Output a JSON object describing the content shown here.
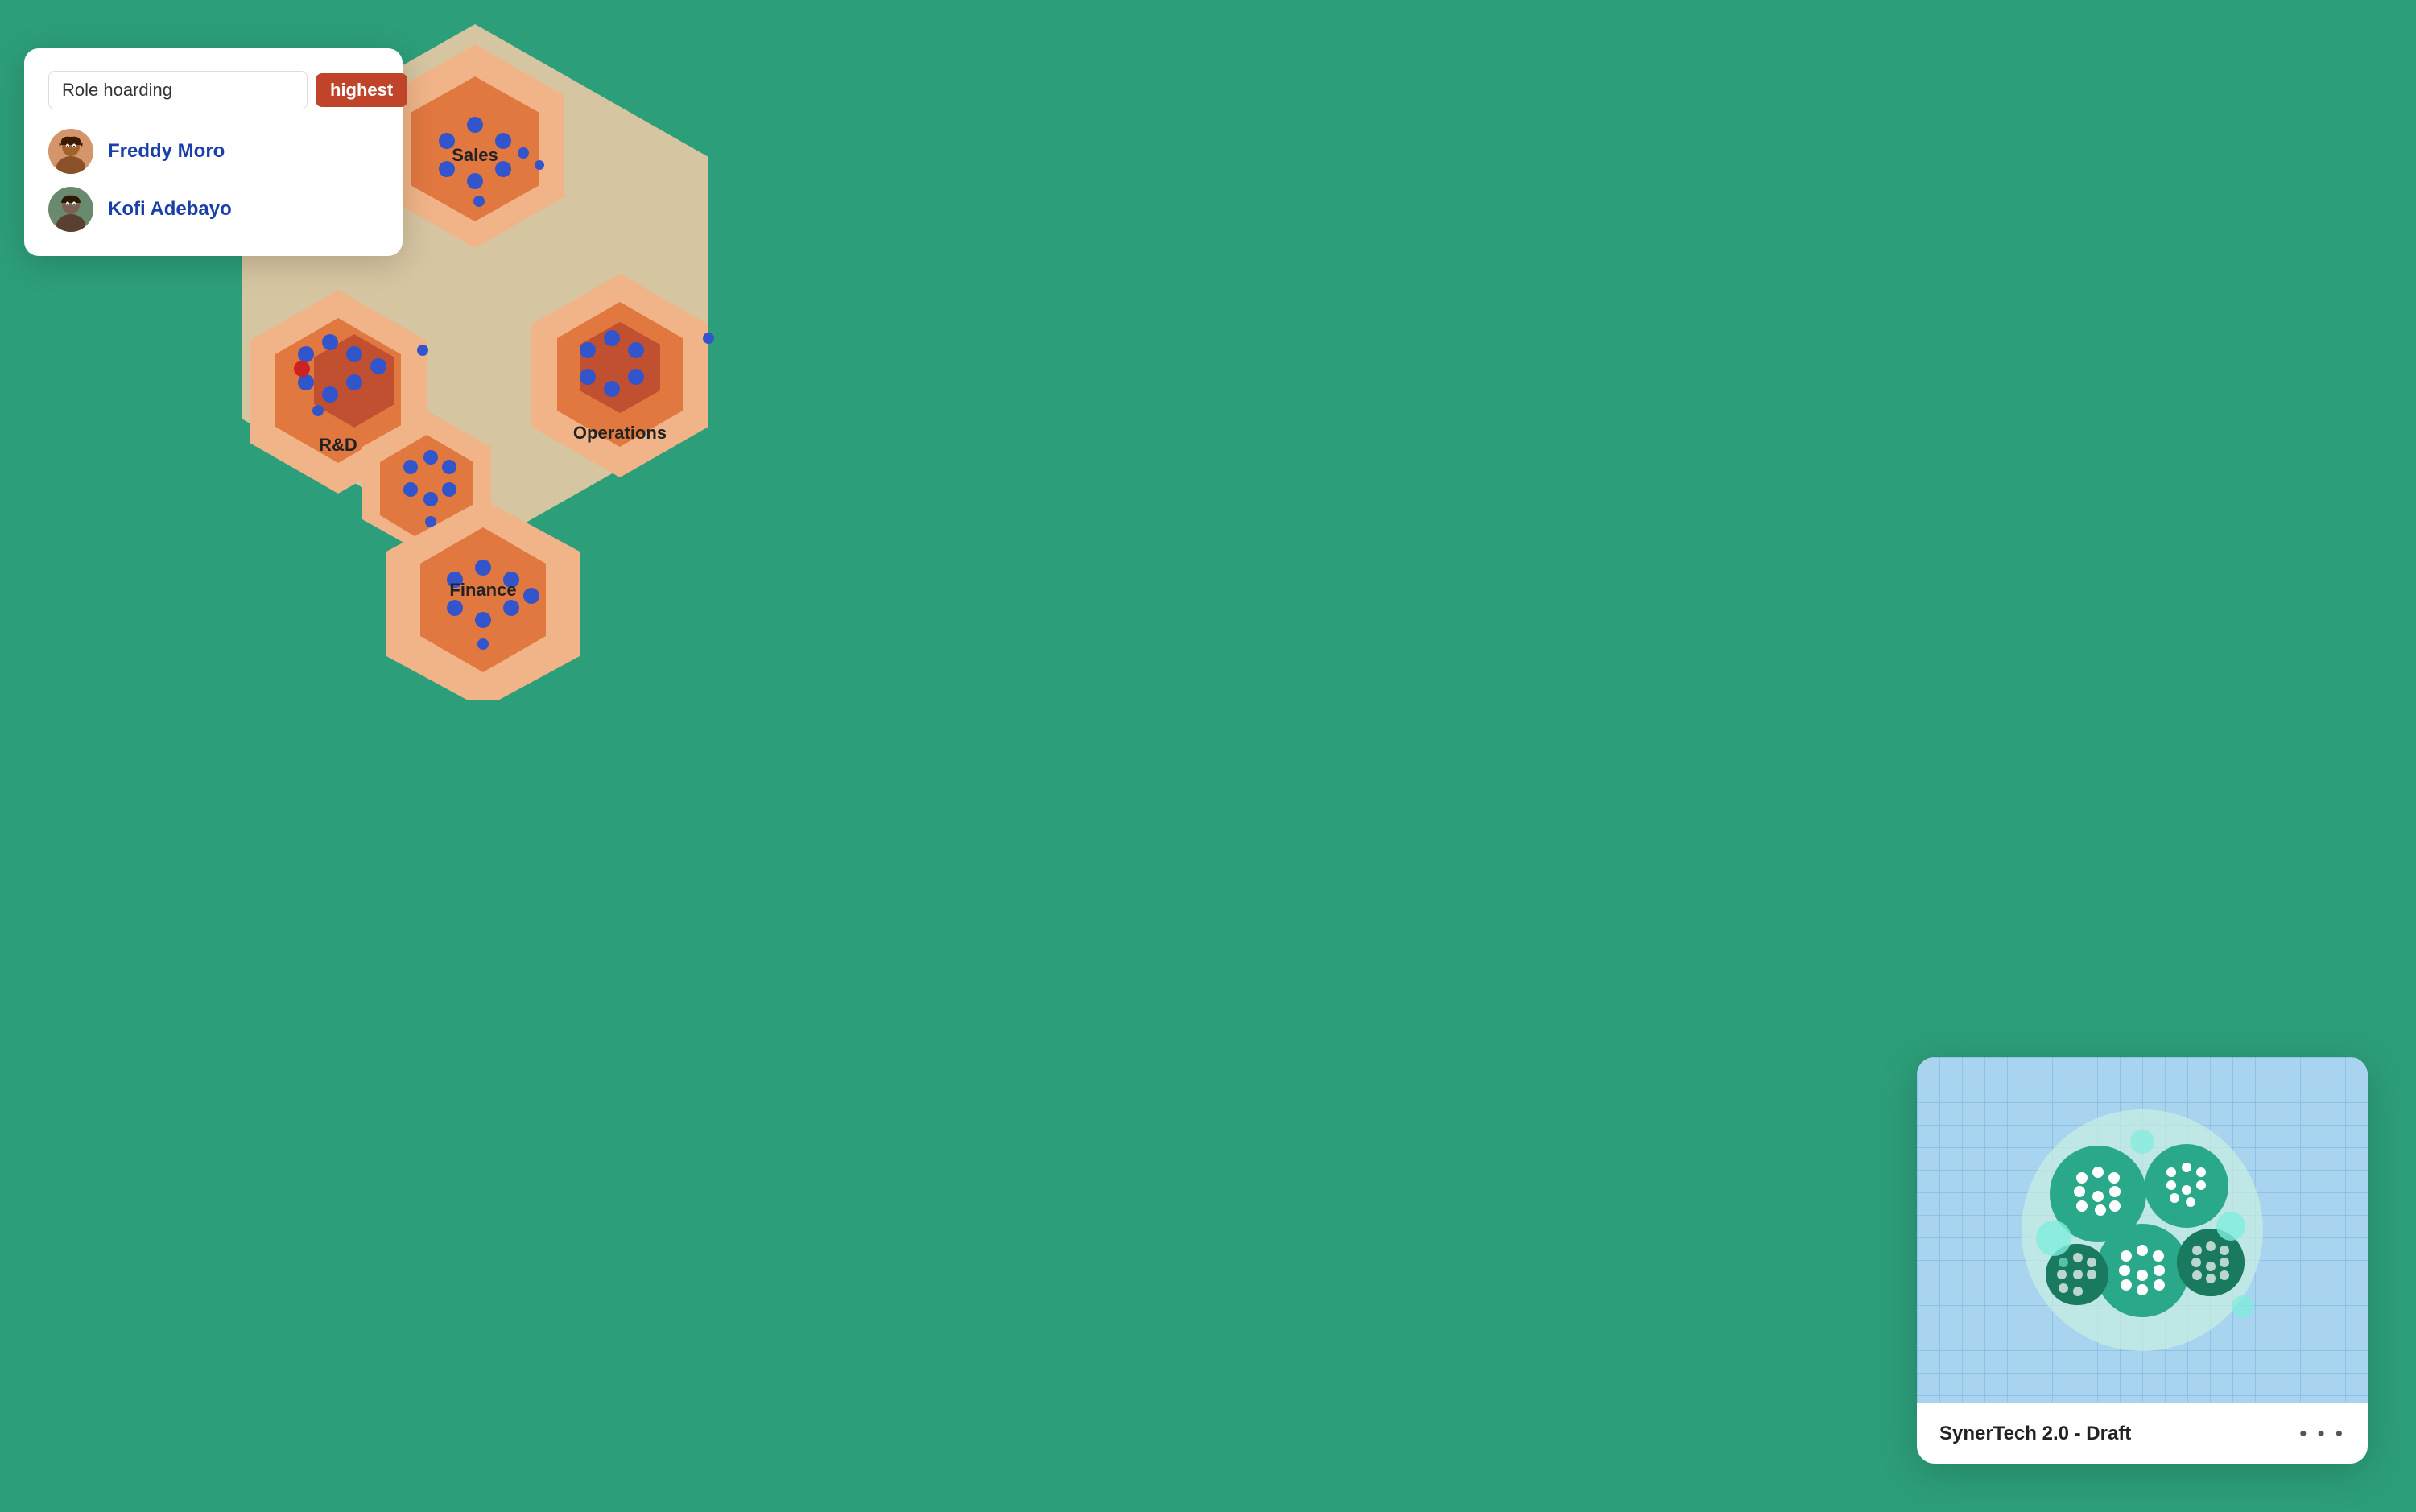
{
  "search_card": {
    "input_value": "Role hoarding",
    "badge_label": "highest",
    "users": [
      {
        "name": "Freddy Moro",
        "avatar_color": "#c5a067"
      },
      {
        "name": "Kofi Adebayo",
        "avatar_color": "#8a9a7a"
      }
    ]
  },
  "hex_labels": {
    "sales": "Sales",
    "rd": "R&D",
    "operations": "Operations",
    "finance": "Finance"
  },
  "syner_card": {
    "title": "SynerTech 2.0 - Draft",
    "dots": "• • •"
  },
  "colors": {
    "hex_light": "#f5c9a8",
    "hex_mid": "#e89060",
    "hex_dark": "#c05030",
    "dot_blue": "#4466cc",
    "teal_light": "#7eeedd",
    "teal_mid": "#2aa88a",
    "teal_dark": "#1a7a60"
  }
}
